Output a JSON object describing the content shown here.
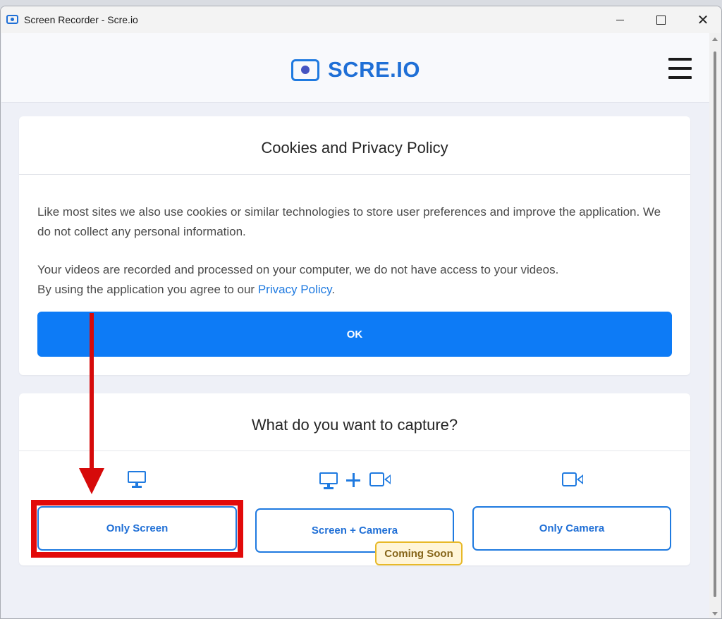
{
  "window": {
    "title": "Screen Recorder - Scre.io",
    "controls": {
      "minimize": "",
      "maximize": "",
      "close": "✕"
    }
  },
  "header": {
    "logo_text": "SCRE.IO",
    "menu_icon": "hamburger-menu-icon"
  },
  "cookies": {
    "title": "Cookies and Privacy Policy",
    "paragraph1": "Like most sites we also use cookies or similar technologies to store user preferences and improve the application. We do not collect any personal information.",
    "paragraph2_line1": "Your videos are recorded and processed on your computer, we do not have access to your videos.",
    "paragraph2_prefix": "By using the application you agree to our ",
    "privacy_link": "Privacy Policy",
    "paragraph2_suffix": ".",
    "ok_label": "OK"
  },
  "capture": {
    "title": "What do you want to capture?",
    "options": [
      {
        "label": "Only Screen",
        "icon": "monitor-icon"
      },
      {
        "label": "Screen + Camera",
        "icon": "monitor-plus-camera-icon",
        "badge": "Coming Soon"
      },
      {
        "label": "Only Camera",
        "icon": "camera-icon"
      }
    ]
  },
  "colors": {
    "accent": "#0d7bf6",
    "brand": "#1f6fd6",
    "annotation_red": "#e20a0a",
    "badge_border": "#e8b928",
    "badge_text": "#86651a"
  }
}
